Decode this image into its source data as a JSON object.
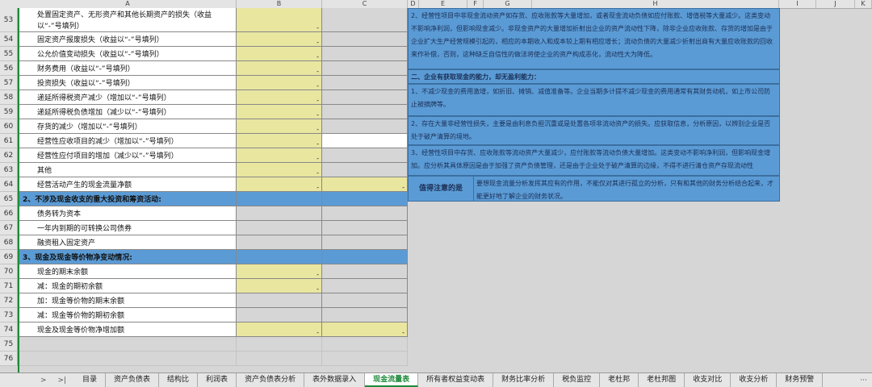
{
  "columns": [
    "A",
    "B",
    "C",
    "D",
    "E",
    "F",
    "G",
    "H",
    "I",
    "J",
    "K"
  ],
  "rows": [
    {
      "num": "53",
      "label": "处置固定资产、无形资产和其他长期资产的损失（收益以“-”号填列）",
      "b": "-",
      "c": "",
      "wrap": true
    },
    {
      "num": "54",
      "label": "固定资产报废损失（收益以“-”号填列）",
      "b": "-",
      "c": ""
    },
    {
      "num": "55",
      "label": "公允价值变动损失（收益以“-”号填列）",
      "b": "-",
      "c": ""
    },
    {
      "num": "56",
      "label": "财务费用（收益以“-”号填列）",
      "b": "-",
      "c": ""
    },
    {
      "num": "57",
      "label": "投资损失（收益以“-”号填列）",
      "b": "-",
      "c": ""
    },
    {
      "num": "58",
      "label": "递延所得税资产减少（增加以“-”号填列）",
      "b": "-",
      "c": ""
    },
    {
      "num": "59",
      "label": "递延所得税负债增加（减少以“-”号填列）",
      "b": "-",
      "c": ""
    },
    {
      "num": "60",
      "label": "存货的减少（增加以“-”号填列）",
      "b": "-",
      "c": ""
    },
    {
      "num": "61",
      "label": "经营性应收项目的减少（增加以“-”号填列）",
      "b": "-",
      "c": ""
    },
    {
      "num": "62",
      "label": "经营性应付项目的增加（减少以“-”号填列）",
      "b": "-",
      "c": ""
    },
    {
      "num": "63",
      "label": "其他",
      "b": "-",
      "c": ""
    },
    {
      "num": "64",
      "label": "经营活动产生的现金流量净额",
      "b": "-",
      "c": "-"
    },
    {
      "num": "65",
      "label": "2、不涉及现金收支的重大投资和筹资活动:",
      "b": "",
      "c": "",
      "section": true
    },
    {
      "num": "66",
      "label": "债务转为资本",
      "b": "",
      "c": ""
    },
    {
      "num": "67",
      "label": "一年内到期的可转换公司债券",
      "b": "",
      "c": ""
    },
    {
      "num": "68",
      "label": "融资租入固定资产",
      "b": "",
      "c": ""
    },
    {
      "num": "69",
      "label": "3、现金及现金等价物净变动情况:",
      "b": "",
      "c": "",
      "section": true
    },
    {
      "num": "70",
      "label": "现金的期末余额",
      "b": "-",
      "c": ""
    },
    {
      "num": "71",
      "label": "减：现金的期初余额",
      "b": "-",
      "c": ""
    },
    {
      "num": "72",
      "label": "加：现金等价物的期末余额",
      "b": "",
      "c": ""
    },
    {
      "num": "73",
      "label": "减：现金等价物的期初余额",
      "b": "",
      "c": ""
    },
    {
      "num": "74",
      "label": "现金及现金等价物净增加额",
      "b": "-",
      "c": "-"
    },
    {
      "num": "75",
      "label": "",
      "b": "",
      "c": ""
    },
    {
      "num": "76",
      "label": "",
      "b": "",
      "c": ""
    }
  ],
  "notes": [
    {
      "text": "2、经营性项目中非现金流动资产如存货、应收账款等大量增加，或者现金流动负债如应付账款、增值税等大量减少。这类变动不影响净利润，但影响现金减少。非现金资产的大量增加折射出企业的资产流动性下降，除非企业应收账款、存货的增加是由于企业扩大生产经营规模引起的，相应的本期收入和成本较上期有相应增长；流动负债的大量减少折射出商有大量应收账款的回收来作补偿，否则，这种缺乏自信性的做法将使企业的资产构成恶化，流动性大为降低。"
    },
    {
      "text": "二、企业有获取现金的能力，却无盈利能力："
    },
    {
      "text": "1、不减少现金的费用激增，如折旧、摊销、减值准备等。企业当期多计提不减少现金的费用通常有其财务动机，如上市公司防止被摘牌等。"
    },
    {
      "text": "2、存在大量非经营性损失，主要是由利息负担沉重或是处置各项非流动资产的损失。应获取信息，分析原因，以辨别企业是否处于破产清算的境地。"
    },
    {
      "text": "3、经营性项目中存货、应收账款等流动资产大量减少，应付账款等流动负债大量增加。这类变动不影响净利润，但影响现金增加。应分析其具体原因是由于加强了资产负债管理，还是由于企业处于破产清算的边缘，不得不进行清仓资产存现流动性"
    }
  ],
  "warning": {
    "label": "值得注意的是",
    "text": "要想现金流量分析发挥其应有的作用，不能仅对其进行孤立的分析，只有和其他的财务分析结合起来，才能更好地了解企业的财务状况。"
  },
  "tabs": [
    "目录",
    "资产负债表",
    "结构比",
    "利润表",
    "资产负债表分析",
    "表外数据录入",
    "现金流量表",
    "所有者权益变动表",
    "财务比率分析",
    "税负监控",
    "老杜邦",
    "老杜邦图",
    "收支对比",
    "收支分析",
    "财务预警"
  ],
  "active_tab": "现金流量表",
  "nav": {
    "prev": ">",
    "last": ">|",
    "more": "···"
  }
}
